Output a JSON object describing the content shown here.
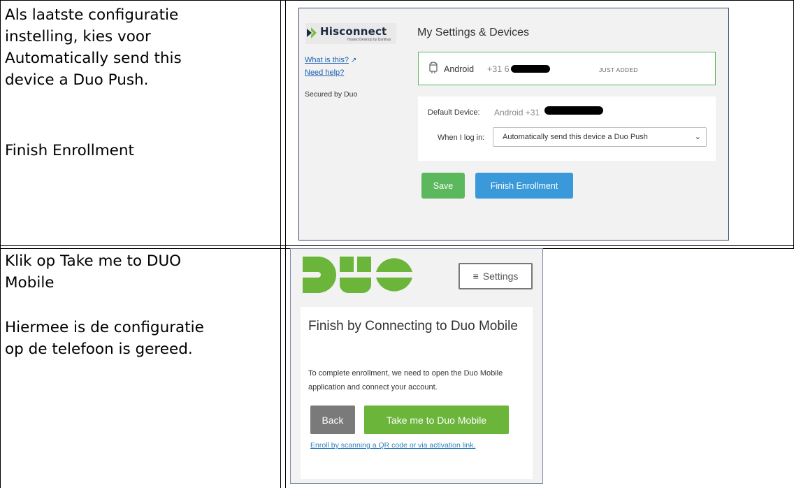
{
  "rows": [
    {
      "instruction_lines": [
        "Als laatste configuratie",
        "instelling, kies voor",
        "Automatically send this",
        "device a Duo Push."
      ],
      "instruction_extra": "Finish Enrollment"
    },
    {
      "instruction_lines": [
        "Klik op Take me to DUO",
        "Mobile"
      ],
      "instruction_extra_lines": [
        "Hiermee is de configuratie",
        "op de telefoon is gereed."
      ]
    }
  ],
  "settings_screen": {
    "logo_name": "Hisconnect",
    "logo_subtitle": "Hosted Desktop by Danthas",
    "what_is_this": "What is this?",
    "need_help": "Need help?",
    "secured_by": "Secured by Duo",
    "title": "My Settings & Devices",
    "device_name": "Android",
    "device_number_visible": "+31 6",
    "device_badge": "JUST ADDED",
    "default_device_label": "Default Device:",
    "default_device_value": "Android +31",
    "login_label": "When I log in:",
    "login_option": "Automatically send this device a Duo Push",
    "save_label": "Save",
    "finish_label": "Finish Enrollment",
    "accent_green": "#5cb85c",
    "accent_blue": "#3a9ad9"
  },
  "duo_screen": {
    "settings_label": "Settings",
    "title": "Finish by Connecting to Duo Mobile",
    "body": "To complete enrollment, we need to open the Duo Mobile application and connect your account.",
    "back_label": "Back",
    "take_label": "Take me to Duo Mobile",
    "enroll_link": "Enroll by scanning a QR code or via activation link.",
    "brand_green": "#6bb53a"
  }
}
